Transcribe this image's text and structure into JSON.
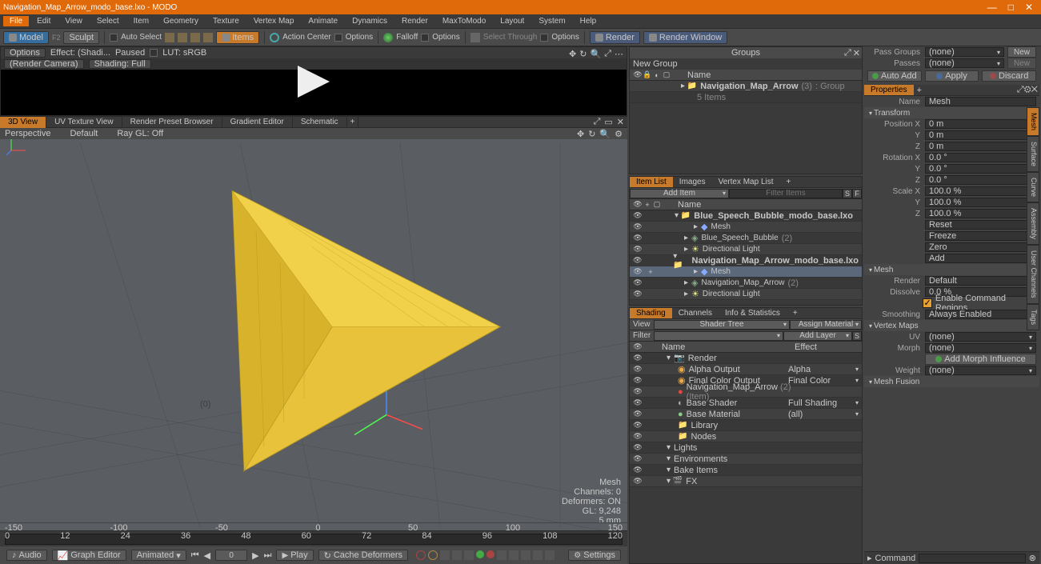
{
  "titlebar": {
    "title": "Navigation_Map_Arrow_modo_base.lxo - MODO"
  },
  "menubar": [
    "File",
    "Edit",
    "View",
    "Select",
    "Item",
    "Geometry",
    "Texture",
    "Vertex Map",
    "Animate",
    "Dynamics",
    "Render",
    "MaxToModo",
    "Layout",
    "System",
    "Help"
  ],
  "toolbar": {
    "model": "Model",
    "f2": "F2",
    "sculpt": "Sculpt",
    "autoselect": "Auto Select",
    "items": "Items",
    "actioncenter": "Action Center",
    "options1": "Options",
    "falloff": "Falloff",
    "options2": "Options",
    "selectthrough": "Select Through",
    "options3": "Options",
    "render": "Render",
    "renderwindow": "Render Window"
  },
  "preview": {
    "options": "Options",
    "effect": "Effect: (Shadi...",
    "paused": "Paused",
    "lut": "LUT: sRGB",
    "rendercam": "(Render Camera)",
    "shading": "Shading: Full"
  },
  "viewtabs": [
    "3D View",
    "UV Texture View",
    "Render Preset Browser",
    "Gradient Editor",
    "Schematic"
  ],
  "viewsub": {
    "perspective": "Perspective",
    "default": "Default",
    "raygl": "Ray GL: Off"
  },
  "vpstats": {
    "mesh": "Mesh",
    "channels": "Channels: 0",
    "deformers": "Deformers: ON",
    "gl": "GL: 9,248",
    "mm": "5 mm"
  },
  "timeline_ticks": [
    "0",
    "12",
    "24",
    "36",
    "48",
    "60",
    "72",
    "84",
    "96",
    "108",
    "120"
  ],
  "bottombar": {
    "audio": "Audio",
    "grapheditor": "Graph Editor",
    "animated": "Animated",
    "frame": "0",
    "play": "Play",
    "cachedeform": "Cache Deformers",
    "settings": "Settings"
  },
  "groups": {
    "title": "Groups",
    "newgroup": "New Group",
    "name": "Name",
    "item": "Navigation_Map_Arrow",
    "suffix": "(3)",
    "type": ": Group",
    "sub": "5 Items"
  },
  "itemlist": {
    "tabs": [
      "Item List",
      "Images",
      "Vertex Map List"
    ],
    "additem": "Add Item",
    "filter": "Filter Items",
    "name": "Name",
    "items": [
      {
        "label": "Blue_Speech_Bubble_modo_base.lxo",
        "indent": 0,
        "bold": true,
        "icon": "scene"
      },
      {
        "label": "Mesh",
        "indent": 2,
        "icon": "mesh"
      },
      {
        "label": "Blue_Speech_Bubble",
        "suffix": "(2)",
        "indent": 1,
        "icon": "loc"
      },
      {
        "label": "Directional Light",
        "indent": 1,
        "icon": "light"
      },
      {
        "label": "Navigation_Map_Arrow_modo_base.lxo",
        "indent": 0,
        "bold": true,
        "icon": "scene"
      },
      {
        "label": "Mesh",
        "indent": 2,
        "sel": true,
        "icon": "mesh"
      },
      {
        "label": "Navigation_Map_Arrow",
        "suffix": "(2)",
        "indent": 1,
        "icon": "loc"
      },
      {
        "label": "Directional Light",
        "indent": 1,
        "icon": "light"
      }
    ]
  },
  "shading": {
    "tabs": [
      "Shading",
      "Channels",
      "Info & Statistics"
    ],
    "view": "View",
    "viewval": "Shader Tree",
    "assign": "Assign Material",
    "filter": "Filter",
    "filterval": "",
    "addlayer": "Add Layer",
    "name": "Name",
    "effect": "Effect",
    "rows": [
      {
        "label": "Render",
        "indent": 0,
        "effect": "",
        "icon": "cam"
      },
      {
        "label": "Alpha Output",
        "indent": 1,
        "effect": "Alpha",
        "icon": "out"
      },
      {
        "label": "Final Color Output",
        "indent": 1,
        "effect": "Final Color",
        "icon": "out"
      },
      {
        "label": "Navigation_Map_Arrow",
        "suffix": "(2) (Item)",
        "indent": 1,
        "effect": "",
        "icon": "mat",
        "red": true
      },
      {
        "label": "Base Shader",
        "indent": 1,
        "effect": "Full Shading",
        "icon": "shd"
      },
      {
        "label": "Base Material",
        "indent": 1,
        "effect": "(all)",
        "icon": "mat"
      },
      {
        "label": "Library",
        "indent": 1,
        "effect": "",
        "icon": "fld"
      },
      {
        "label": "Nodes",
        "indent": 1,
        "effect": "",
        "icon": "fld"
      },
      {
        "label": "Lights",
        "indent": 0,
        "effect": ""
      },
      {
        "label": "Environments",
        "indent": 0,
        "effect": ""
      },
      {
        "label": "Bake Items",
        "indent": 0,
        "effect": ""
      },
      {
        "label": "FX",
        "indent": 0,
        "effect": "",
        "icon": "fx"
      }
    ]
  },
  "rightpanel": {
    "passgroups": "Pass Groups",
    "passes": "Passes",
    "none": "(none)",
    "new": "New",
    "autoadd": "Auto Add",
    "apply": "Apply",
    "discard": "Discard",
    "properties": "Properties",
    "name": "Name",
    "nameval": "Mesh",
    "transform": "Transform",
    "position": {
      "x": "Position X",
      "y": "Y",
      "z": "Z",
      "vx": "0 m",
      "vy": "0 m",
      "vz": "0 m"
    },
    "rotation": {
      "x": "Rotation X",
      "y": "Y",
      "z": "Z",
      "vx": "0.0 °",
      "vy": "0.0 °",
      "vz": "0.0 °"
    },
    "scale": {
      "x": "Scale X",
      "y": "Y",
      "z": "Z",
      "vx": "100.0 %",
      "vy": "100.0 %",
      "vz": "100.0 %"
    },
    "reset": "Reset",
    "freeze": "Freeze",
    "zero": "Zero",
    "add": "Add",
    "mesh": "Mesh",
    "render": "Render",
    "renderval": "Default",
    "dissolve": "Dissolve",
    "dissolveval": "0.0 %",
    "enablecmd": "Enable Command Regions",
    "smoothing": "Smoothing",
    "smoothingval": "Always Enabled",
    "vertexmaps": "Vertex Maps",
    "uv": "UV",
    "morph": "Morph",
    "addmorph": "Add Morph Influence",
    "weight": "Weight",
    "meshfusion": "Mesh Fusion",
    "tabs": [
      "Mesh",
      "Surface",
      "Curve",
      "Assembly",
      "User Channels",
      "Tags"
    ],
    "command": "Command"
  }
}
